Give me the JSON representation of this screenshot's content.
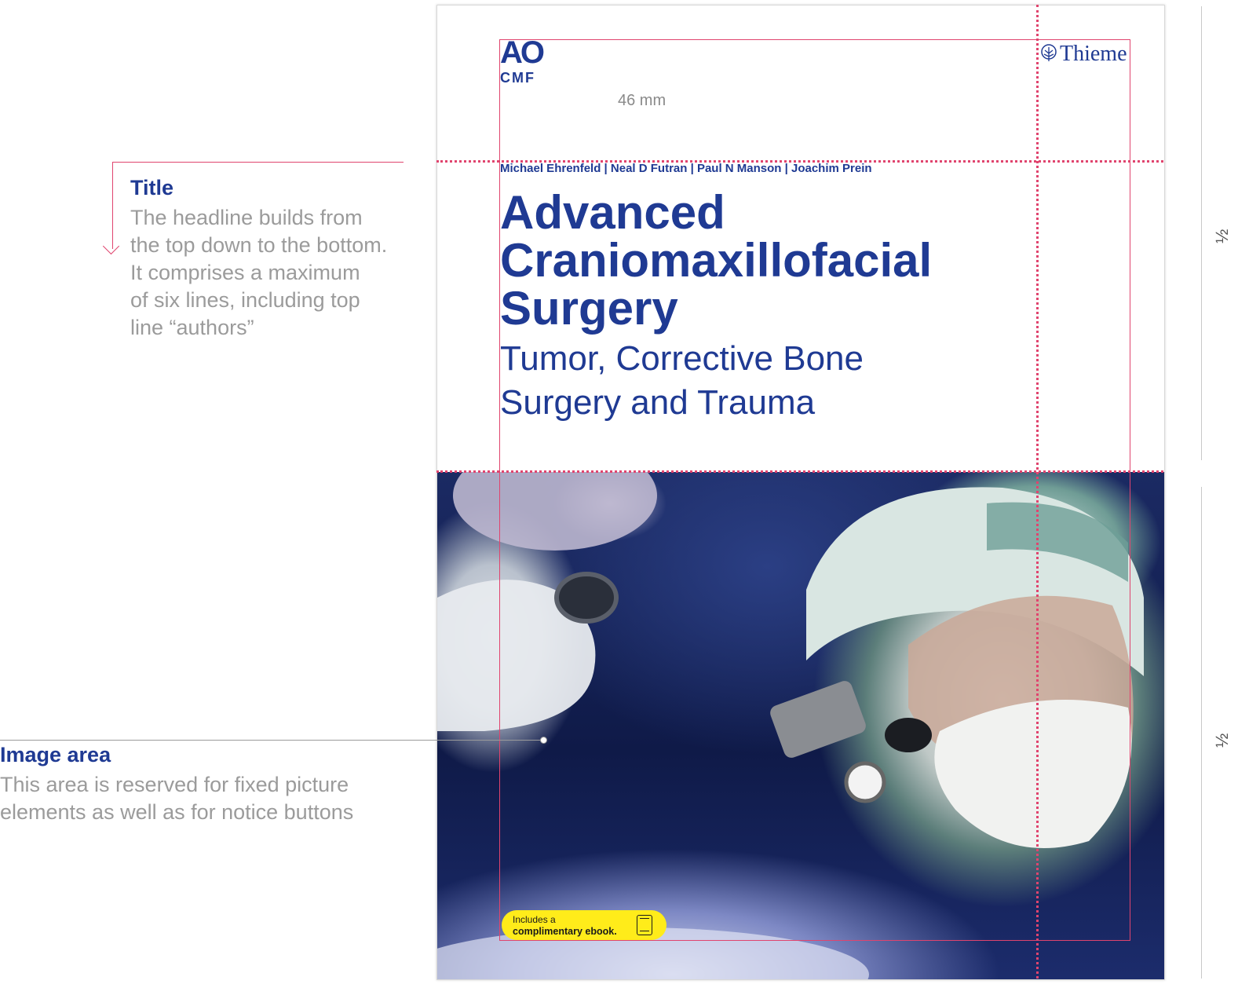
{
  "annotations": {
    "title": {
      "heading": "Title",
      "text": "The headline builds from\nthe top down to the bottom.\nIt comprises a maximum\nof six lines, including top\nline “authors”"
    },
    "image_area": {
      "heading": "Image area",
      "text": "This area is reserved for fixed picture\nelements as well as for notice buttons"
    }
  },
  "cover": {
    "logo_ao": "AO",
    "logo_cmf": "CMF",
    "publisher": "Thieme",
    "dimension_label": "46 mm",
    "authors": "Michael Ehrenfeld  |  Neal D Futran  |  Paul N Manson  |  Joachim Prein",
    "title": "Advanced\nCraniomaxillofacial\nSurgery",
    "subtitle": "Tumor, Corrective Bone\nSurgery and Trauma",
    "badge": {
      "line1": "Includes a",
      "line2": "complimentary ebook.",
      "icon": "tablet-icon",
      "color": "#ffec1a"
    }
  },
  "ruler": {
    "upper": "½",
    "lower": "½"
  },
  "colors": {
    "brand_blue": "#1f3a93",
    "guide_pink": "#e0446e",
    "annotation_gray": "#9b9b9b"
  }
}
